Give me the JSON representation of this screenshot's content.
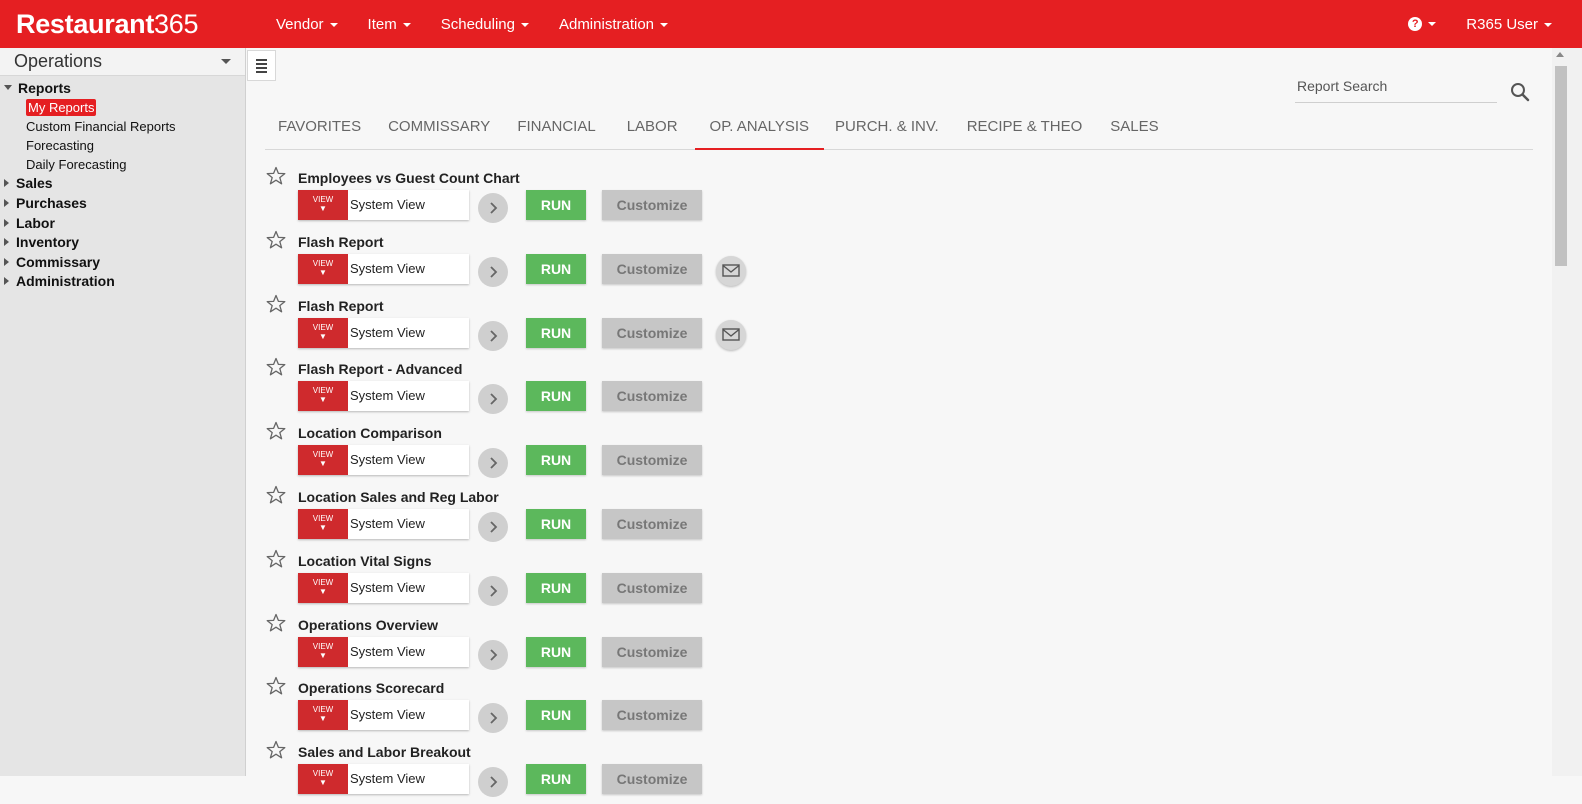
{
  "brand": {
    "name_bold": "Restaurant",
    "name_light": "365"
  },
  "nav": [
    {
      "label": "Vendor"
    },
    {
      "label": "Item"
    },
    {
      "label": "Scheduling"
    },
    {
      "label": "Administration"
    }
  ],
  "header_right": {
    "help_glyph": "?",
    "user": "R365 User"
  },
  "sidebar": {
    "module": "Operations",
    "tree": [
      {
        "label": "Reports",
        "expanded": true
      },
      {
        "label": "My Reports",
        "selected": true
      },
      {
        "label": "Custom Financial Reports"
      },
      {
        "label": "Forecasting"
      },
      {
        "label": "Daily Forecasting"
      },
      {
        "label": "Sales"
      },
      {
        "label": "Purchases"
      },
      {
        "label": "Labor"
      },
      {
        "label": "Inventory"
      },
      {
        "label": "Commissary"
      },
      {
        "label": "Administration"
      }
    ]
  },
  "search": {
    "placeholder": "Report Search"
  },
  "tabs": [
    {
      "label": "FAVORITES"
    },
    {
      "label": "COMMISSARY"
    },
    {
      "label": "FINANCIAL"
    },
    {
      "label": "LABOR"
    },
    {
      "label": "OP. ANALYSIS",
      "active": true
    },
    {
      "label": "PURCH. & INV."
    },
    {
      "label": "RECIPE & THEO"
    },
    {
      "label": "SALES"
    }
  ],
  "controls": {
    "view_label": "VIEW",
    "view_arrow": "▼",
    "view_value": "System View",
    "run_label": "RUN",
    "customize_label": "Customize"
  },
  "reports": [
    {
      "title": "Employees vs Guest Count Chart",
      "email": false
    },
    {
      "title": "Flash Report",
      "email": true
    },
    {
      "title": "Flash Report",
      "email": true
    },
    {
      "title": "Flash Report - Advanced",
      "email": false
    },
    {
      "title": "Location Comparison",
      "email": false
    },
    {
      "title": "Location Sales and Reg Labor",
      "email": false
    },
    {
      "title": "Location Vital Signs",
      "email": false
    },
    {
      "title": "Operations Overview",
      "email": false
    },
    {
      "title": "Operations Scorecard",
      "email": false
    },
    {
      "title": "Sales and Labor Breakout",
      "email": false
    }
  ],
  "colors": {
    "brand_red": "#e51f22",
    "run_green": "#5cb85c",
    "view_red": "#cf2a2d",
    "customize_gray": "#c6c6c6"
  }
}
